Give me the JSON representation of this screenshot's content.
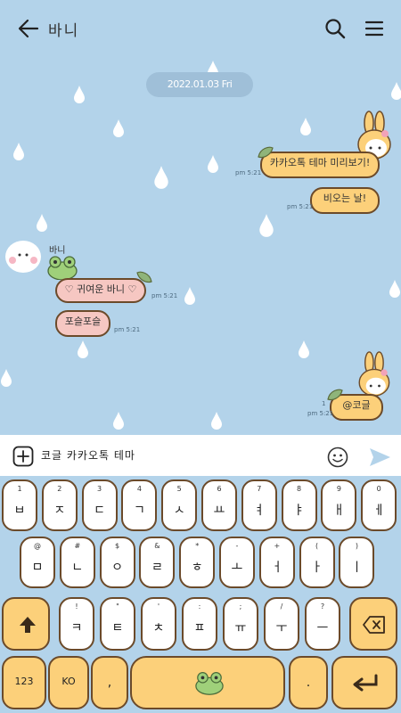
{
  "header": {
    "title": "바니",
    "back_icon": "back-arrow-icon",
    "search_icon": "search-icon",
    "menu_icon": "hamburger-menu-icon"
  },
  "chat": {
    "date": "2022.01.03 Fri",
    "messages_out": [
      {
        "text": "카카오톡 테마 미리보기!",
        "time": "pm 5:21"
      },
      {
        "text": "비오는 날!",
        "time": "pm 5:21"
      }
    ],
    "friend": {
      "name": "바니"
    },
    "messages_in": [
      {
        "text": "♡ 귀여운 바니 ♡",
        "time": "pm 5:21"
      },
      {
        "text": "포슬포슬",
        "time": "pm 5:21"
      }
    ],
    "last_out": {
      "text": "@코글",
      "time": "pm 5:21",
      "unread": "1"
    }
  },
  "input": {
    "value": "코글 카카오톡 테마"
  },
  "keyboard": {
    "row1": [
      {
        "hint": "1",
        "main": "ㅂ"
      },
      {
        "hint": "2",
        "main": "ㅈ"
      },
      {
        "hint": "3",
        "main": "ㄷ"
      },
      {
        "hint": "4",
        "main": "ㄱ"
      },
      {
        "hint": "5",
        "main": "ㅅ"
      },
      {
        "hint": "6",
        "main": "ㅛ"
      },
      {
        "hint": "7",
        "main": "ㅕ"
      },
      {
        "hint": "8",
        "main": "ㅑ"
      },
      {
        "hint": "9",
        "main": "ㅐ"
      },
      {
        "hint": "0",
        "main": "ㅔ"
      }
    ],
    "row2": [
      {
        "hint": "@",
        "main": "ㅁ"
      },
      {
        "hint": "#",
        "main": "ㄴ"
      },
      {
        "hint": "$",
        "main": "ㅇ"
      },
      {
        "hint": "&",
        "main": "ㄹ"
      },
      {
        "hint": "*",
        "main": "ㅎ"
      },
      {
        "hint": "-",
        "main": "ㅗ"
      },
      {
        "hint": "+",
        "main": "ㅓ"
      },
      {
        "hint": "(",
        "main": "ㅏ"
      },
      {
        "hint": ")",
        "main": "ㅣ"
      }
    ],
    "row3": [
      {
        "hint": "!",
        "main": "ㅋ"
      },
      {
        "hint": "\"",
        "main": "ㅌ"
      },
      {
        "hint": "'",
        "main": "ㅊ"
      },
      {
        "hint": ":",
        "main": "ㅍ"
      },
      {
        "hint": ";",
        "main": "ㅠ"
      },
      {
        "hint": "/",
        "main": "ㅜ"
      },
      {
        "hint": "?",
        "main": "ㅡ"
      }
    ],
    "num_label": "123",
    "lang_label": "KO",
    "comma_label": ",",
    "period_label": "."
  }
}
